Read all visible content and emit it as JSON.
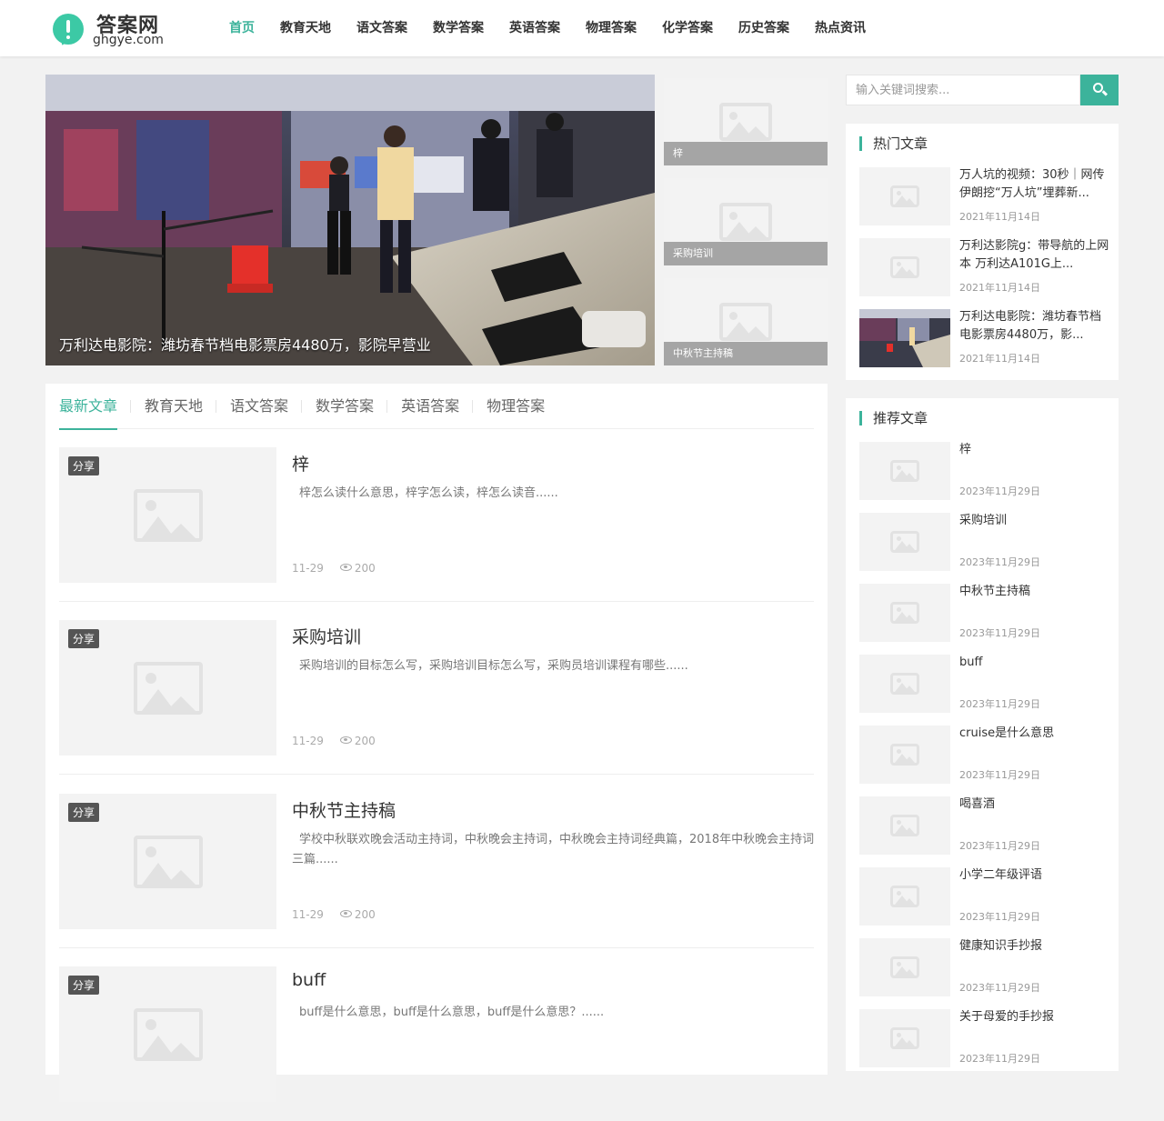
{
  "site": {
    "name": "答案网",
    "domain": "ghgye.com",
    "accent": "#3cb39b"
  },
  "nav": [
    {
      "label": "首页",
      "active": true
    },
    {
      "label": "教育天地"
    },
    {
      "label": "语文答案"
    },
    {
      "label": "数学答案"
    },
    {
      "label": "英语答案"
    },
    {
      "label": "物理答案"
    },
    {
      "label": "化学答案"
    },
    {
      "label": "历史答案"
    },
    {
      "label": "热点资讯"
    }
  ],
  "hero": {
    "caption": "万利达电影院：潍坊春节档电影票房4480万，影院早营业"
  },
  "side_thumbs": [
    {
      "label": "梓"
    },
    {
      "label": "采购培训"
    },
    {
      "label": "中秋节主持稿"
    }
  ],
  "tabs": [
    "最新文章",
    "教育天地",
    "语文答案",
    "数学答案",
    "英语答案",
    "物理答案"
  ],
  "posts": [
    {
      "badge": "分享",
      "title": "梓",
      "desc": "梓怎么读什么意思，梓字怎么读，梓怎么读音......",
      "date": "11-29",
      "views": "200"
    },
    {
      "badge": "分享",
      "title": "采购培训",
      "desc": "采购培训的目标怎么写，采购培训目标怎么写，采购员培训课程有哪些......",
      "date": "11-29",
      "views": "200"
    },
    {
      "badge": "分享",
      "title": "中秋节主持稿",
      "desc": "学校中秋联欢晚会活动主持词，中秋晚会主持词，中秋晚会主持词经典篇，2018年中秋晚会主持词三篇......",
      "date": "11-29",
      "views": "200"
    },
    {
      "badge": "分享",
      "title": "buff",
      "desc": "buff是什么意思，buff是什么意思，buff是什么意思？......",
      "date": "",
      "views": ""
    }
  ],
  "search": {
    "placeholder": "输入关键词搜索..."
  },
  "hot": {
    "title": "热门文章",
    "items": [
      {
        "title": "万人坑的视频：30秒｜网传伊朗挖“万人坑”埋葬新...",
        "date": "2021年11月14日"
      },
      {
        "title": "万利达影院g：带导航的上网本 万利达A101G上...",
        "date": "2021年11月14日"
      },
      {
        "title": "万利达电影院：潍坊春节档电影票房4480万，影...",
        "date": "2021年11月14日"
      }
    ]
  },
  "recommend": {
    "title": "推荐文章",
    "items": [
      {
        "title": "梓",
        "date": "2023年11月29日"
      },
      {
        "title": "采购培训",
        "date": "2023年11月29日"
      },
      {
        "title": "中秋节主持稿",
        "date": "2023年11月29日"
      },
      {
        "title": "buff",
        "date": "2023年11月29日"
      },
      {
        "title": "cruise是什么意思",
        "date": "2023年11月29日"
      },
      {
        "title": "喝喜酒",
        "date": "2023年11月29日"
      },
      {
        "title": "小学二年级评语",
        "date": "2023年11月29日"
      },
      {
        "title": "健康知识手抄报",
        "date": "2023年11月29日"
      },
      {
        "title": "关于母爱的手抄报",
        "date": "2023年11月29日"
      }
    ]
  }
}
